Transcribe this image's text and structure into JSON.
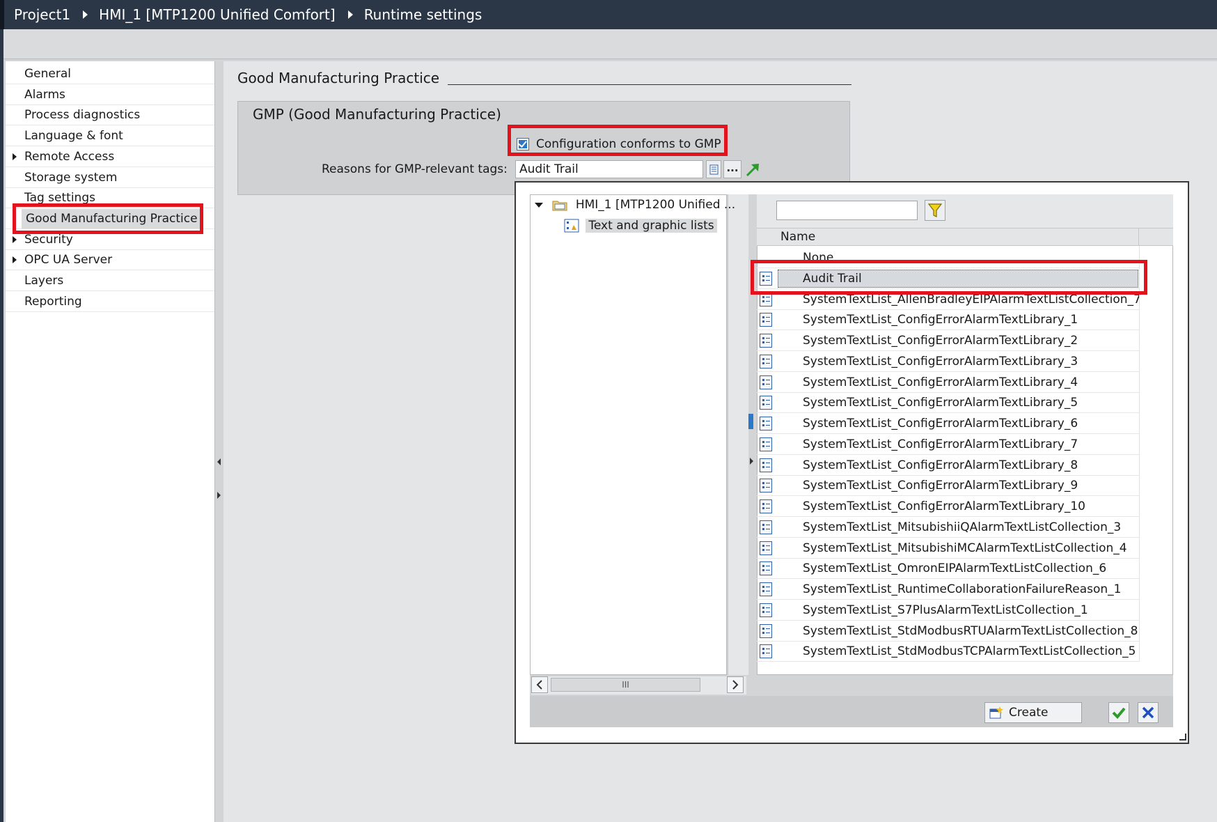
{
  "breadcrumb": [
    "Project1",
    "HMI_1 [MTP1200 Unified Comfort]",
    "Runtime settings"
  ],
  "nav": {
    "items": [
      {
        "label": "General",
        "expandable": false
      },
      {
        "label": "Alarms",
        "expandable": false
      },
      {
        "label": "Process diagnostics",
        "expandable": false
      },
      {
        "label": "Language & font",
        "expandable": false
      },
      {
        "label": "Remote Access",
        "expandable": true
      },
      {
        "label": "Storage system",
        "expandable": false
      },
      {
        "label": "Tag settings",
        "expandable": false
      },
      {
        "label": "Good Manufacturing Practice",
        "expandable": false,
        "selected": true
      },
      {
        "label": "Security",
        "expandable": true
      },
      {
        "label": "OPC UA Server",
        "expandable": true
      },
      {
        "label": "Layers",
        "expandable": false
      },
      {
        "label": "Reporting",
        "expandable": false
      }
    ]
  },
  "section": {
    "title": "Good Manufacturing Practice",
    "group_title": "GMP (Good Manufacturing Practice)",
    "checkbox_label": "Configuration conforms to GMP",
    "checkbox_checked": true,
    "reasons_label": "Reasons for GMP-relevant tags:",
    "reasons_value": "Audit Trail",
    "dots_label": "..."
  },
  "popup": {
    "tree": {
      "root": "HMI_1 [MTP1200 Unified ...",
      "child": "Text and graphic lists"
    },
    "filter_value": "",
    "column_name": "Name",
    "rows": [
      {
        "name": "None",
        "icon": false
      },
      {
        "name": "Audit Trail",
        "icon": true,
        "selected": true
      },
      {
        "name": "SystemTextList_AllenBradleyEIPAlarmTextListCollection_7",
        "icon": true
      },
      {
        "name": "SystemTextList_ConfigErrorAlarmTextLibrary_1",
        "icon": true
      },
      {
        "name": "SystemTextList_ConfigErrorAlarmTextLibrary_2",
        "icon": true
      },
      {
        "name": "SystemTextList_ConfigErrorAlarmTextLibrary_3",
        "icon": true
      },
      {
        "name": "SystemTextList_ConfigErrorAlarmTextLibrary_4",
        "icon": true
      },
      {
        "name": "SystemTextList_ConfigErrorAlarmTextLibrary_5",
        "icon": true
      },
      {
        "name": "SystemTextList_ConfigErrorAlarmTextLibrary_6",
        "icon": true
      },
      {
        "name": "SystemTextList_ConfigErrorAlarmTextLibrary_7",
        "icon": true
      },
      {
        "name": "SystemTextList_ConfigErrorAlarmTextLibrary_8",
        "icon": true
      },
      {
        "name": "SystemTextList_ConfigErrorAlarmTextLibrary_9",
        "icon": true
      },
      {
        "name": "SystemTextList_ConfigErrorAlarmTextLibrary_10",
        "icon": true
      },
      {
        "name": "SystemTextList_MitsubishiiQAlarmTextListCollection_3",
        "icon": true
      },
      {
        "name": "SystemTextList_MitsubishiMCAlarmTextListCollection_4",
        "icon": true
      },
      {
        "name": "SystemTextList_OmronEIPAlarmTextListCollection_6",
        "icon": true
      },
      {
        "name": "SystemTextList_RuntimeCollaborationFailureReason_1",
        "icon": true
      },
      {
        "name": "SystemTextList_S7PlusAlarmTextListCollection_1",
        "icon": true
      },
      {
        "name": "SystemTextList_StdModbusRTUAlarmTextListCollection_8",
        "icon": true
      },
      {
        "name": "SystemTextList_StdModbusTCPAlarmTextListCollection_5",
        "icon": true
      }
    ],
    "create_label": "Create",
    "scroll_thumb_label": "III"
  },
  "colors": {
    "titlebar": "#2b3646",
    "callout": "#e3131e",
    "accent": "#2a78c6",
    "ok_green": "#2e9a2e",
    "cancel_blue": "#1f4fbf"
  }
}
